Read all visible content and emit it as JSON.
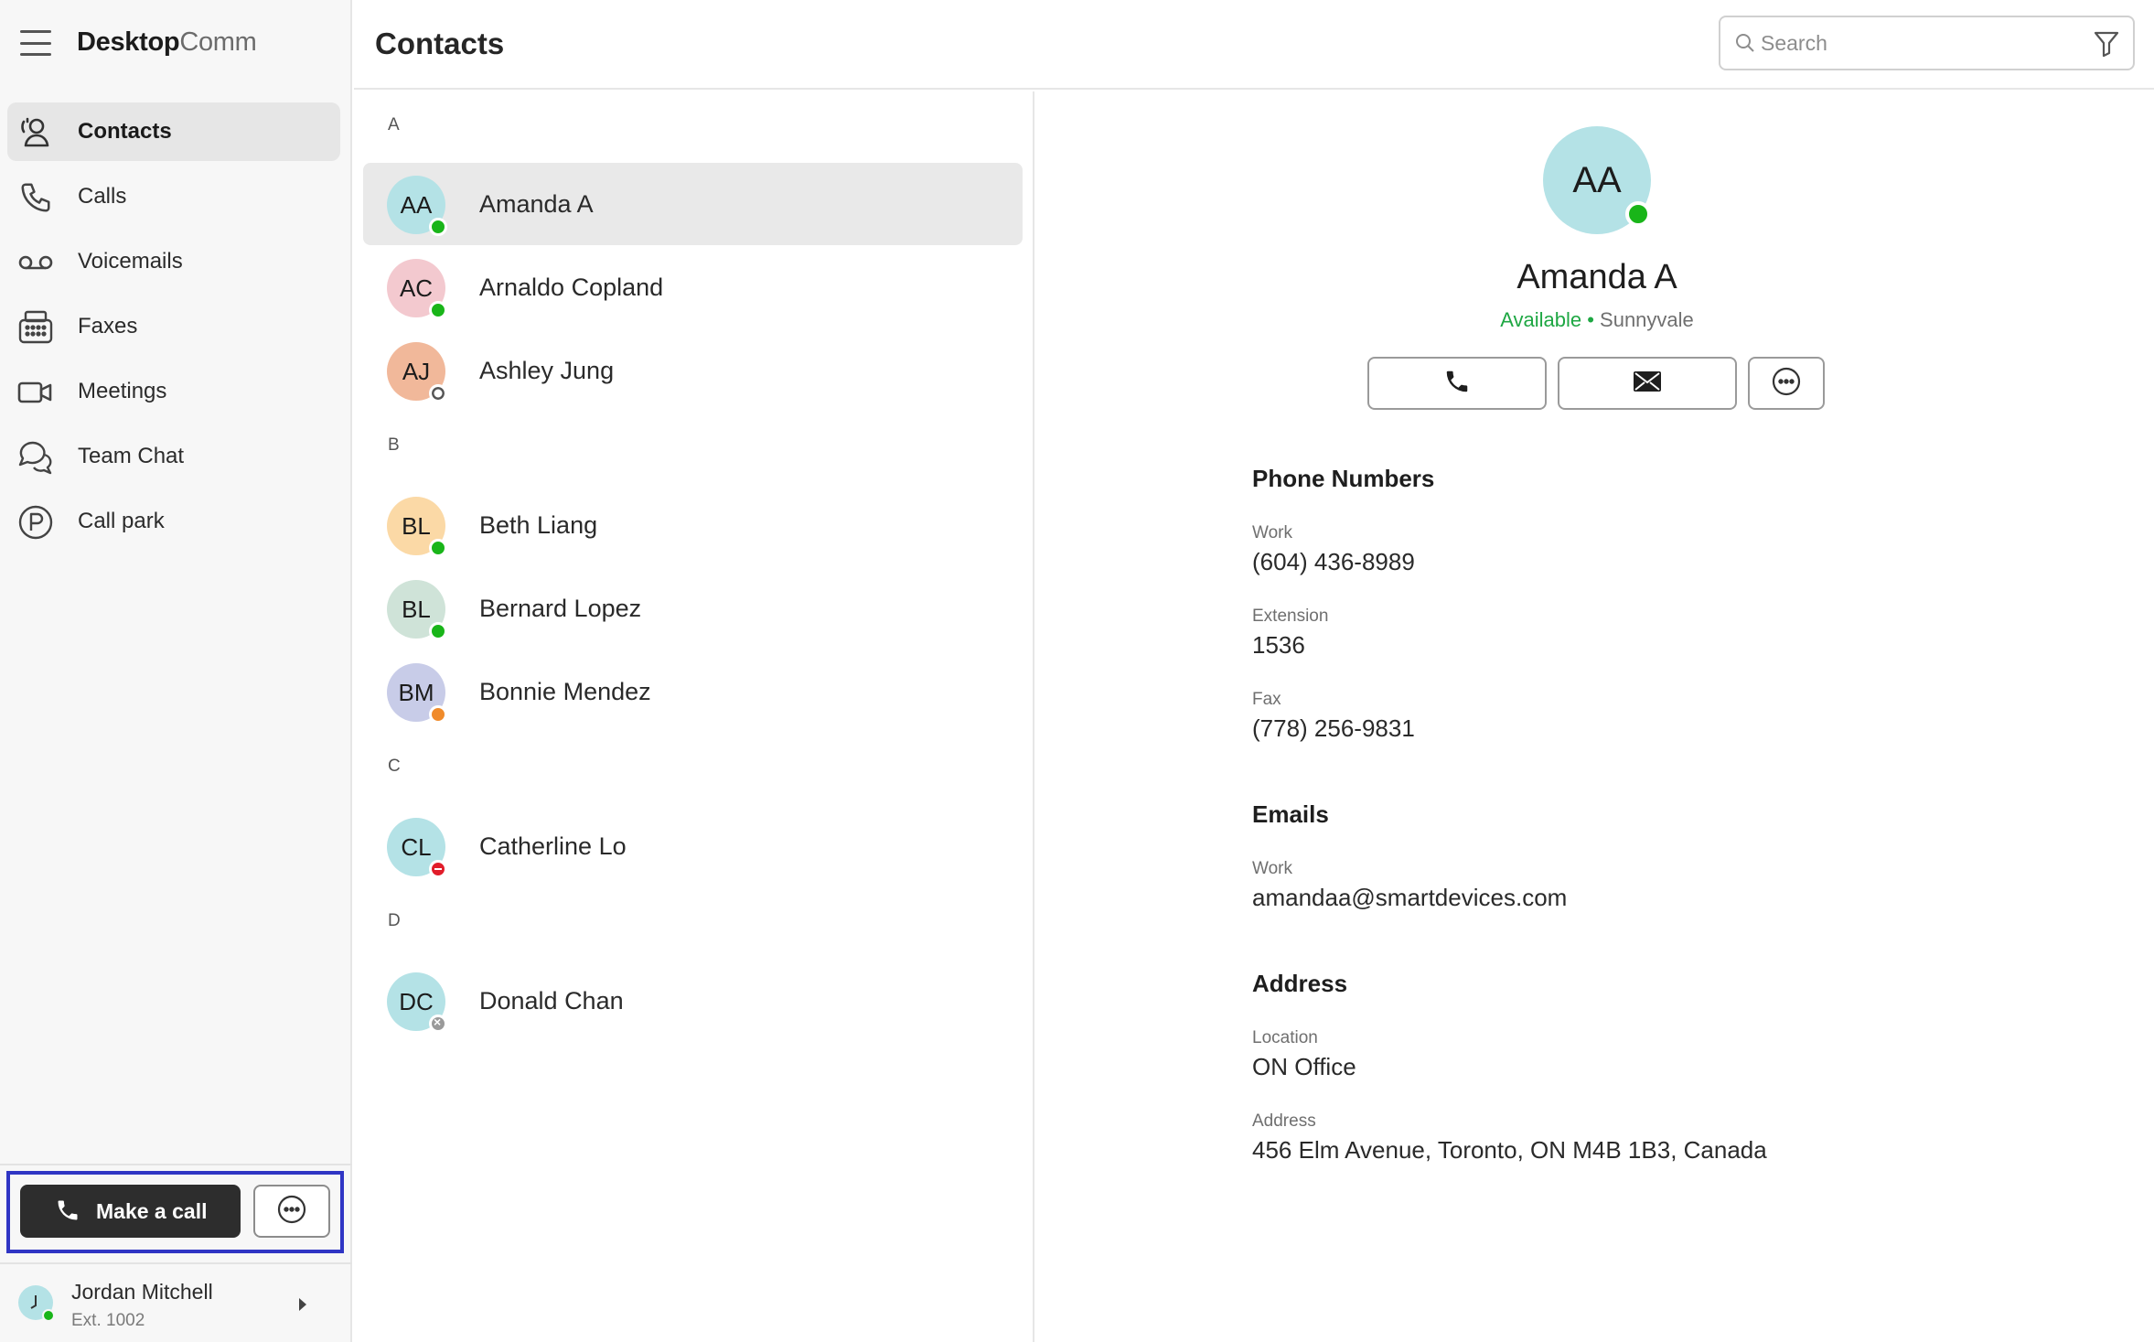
{
  "app": {
    "brand_bold": "Desktop",
    "brand_light": "Comm"
  },
  "sidebar": {
    "items": [
      {
        "label": "Contacts",
        "icon": "contacts-icon",
        "active": true
      },
      {
        "label": "Calls",
        "icon": "phone-icon",
        "active": false
      },
      {
        "label": "Voicemails",
        "icon": "voicemail-icon",
        "active": false
      },
      {
        "label": "Faxes",
        "icon": "fax-icon",
        "active": false
      },
      {
        "label": "Meetings",
        "icon": "video-icon",
        "active": false
      },
      {
        "label": "Team Chat",
        "icon": "chat-icon",
        "active": false
      },
      {
        "label": "Call park",
        "icon": "parking-icon",
        "active": false
      }
    ],
    "make_call_label": "Make a call",
    "user": {
      "name": "Jordan Mitchell",
      "ext": "Ext. 1002",
      "status": "available"
    }
  },
  "header": {
    "title": "Contacts",
    "search_placeholder": "Search"
  },
  "contacts": {
    "groups": [
      {
        "letter": "A",
        "items": [
          {
            "initials": "AA",
            "name": "Amanda A",
            "status": "available",
            "selected": true
          },
          {
            "initials": "AC",
            "name": "Arnaldo Copland",
            "status": "available",
            "selected": false
          },
          {
            "initials": "AJ",
            "name": "Ashley Jung",
            "status": "offline",
            "selected": false
          }
        ]
      },
      {
        "letter": "B",
        "items": [
          {
            "initials": "BL",
            "name": "Beth Liang",
            "status": "available",
            "selected": false
          },
          {
            "initials": "BL",
            "name": "Bernard Lopez",
            "status": "available",
            "selected": false
          },
          {
            "initials": "BM",
            "name": "Bonnie Mendez",
            "status": "away",
            "selected": false
          }
        ]
      },
      {
        "letter": "C",
        "items": [
          {
            "initials": "CL",
            "name": "Catherline Lo",
            "status": "dnd",
            "selected": false
          }
        ]
      },
      {
        "letter": "D",
        "items": [
          {
            "initials": "DC",
            "name": "Donald Chan",
            "status": "unknown",
            "selected": false
          }
        ]
      }
    ]
  },
  "detail": {
    "initials": "AA",
    "name": "Amanda A",
    "status_text": "Available",
    "separator": " • ",
    "location": "Sunnyvale",
    "phone_section": "Phone Numbers",
    "phones": [
      {
        "label": "Work",
        "value": "(604) 436-8989"
      },
      {
        "label": "Extension",
        "value": "1536"
      },
      {
        "label": "Fax",
        "value": "(778) 256-9831"
      }
    ],
    "emails_section": "Emails",
    "emails": [
      {
        "label": "Work",
        "value": "amandaa@smartdevices.com"
      }
    ],
    "address_section": "Address",
    "address": [
      {
        "label": "Location",
        "value": "ON Office"
      },
      {
        "label": "Address",
        "value": "456 Elm Avenue, Toronto, ON M4B 1B3, Canada"
      }
    ]
  },
  "colors": {
    "accent_highlight": "#2f35c4",
    "available": "#19b519",
    "away": "#f08b2b",
    "dnd": "#e11d2a"
  }
}
